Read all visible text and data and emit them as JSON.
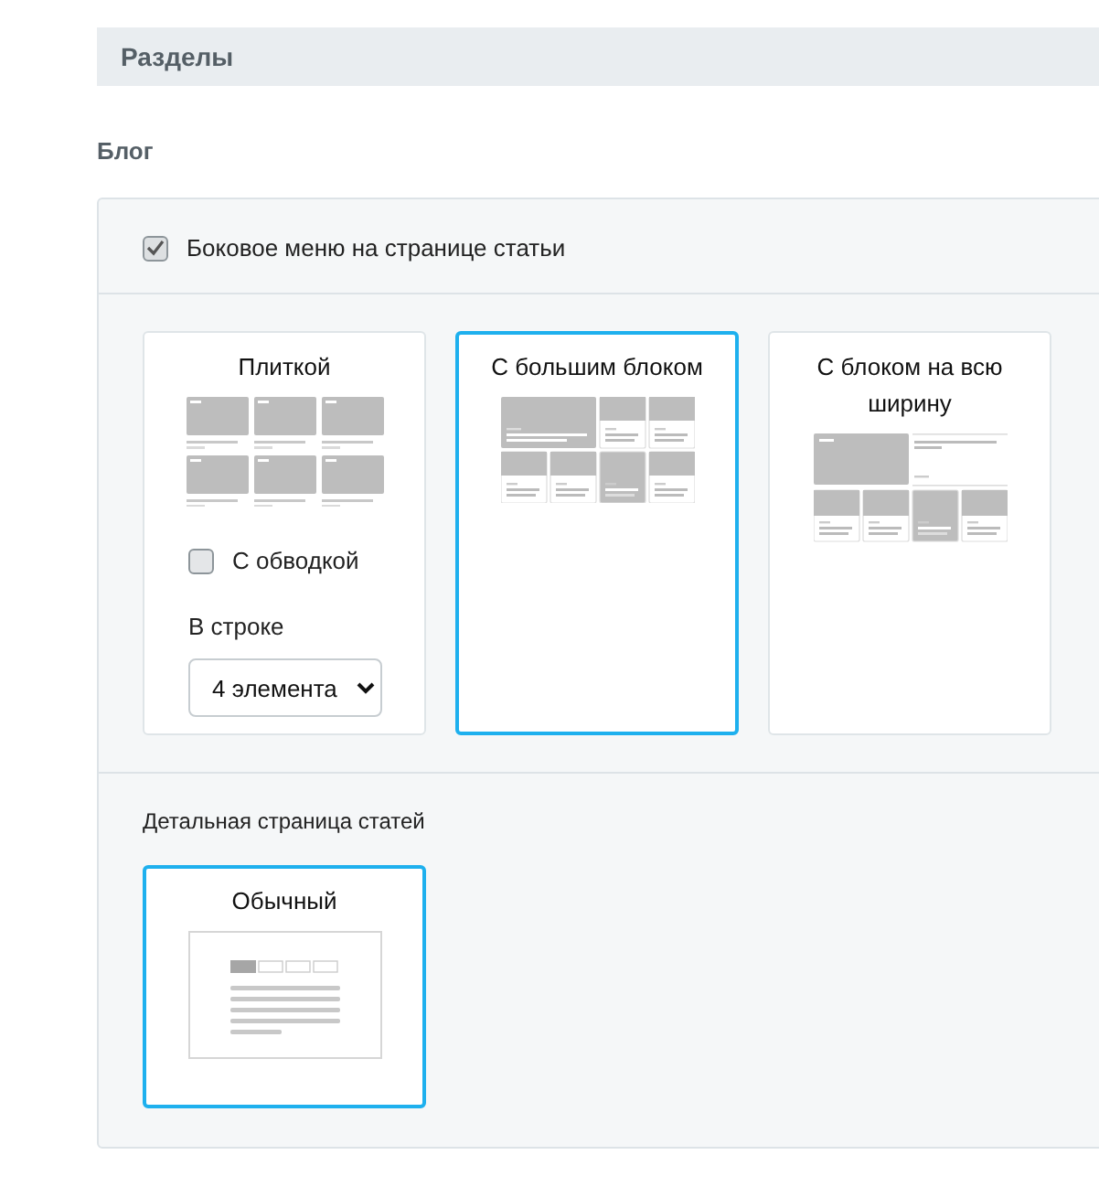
{
  "header": {
    "title": "Разделы"
  },
  "section": {
    "title": "Блог",
    "side_menu": {
      "label": "Боковое меню на странице статьи",
      "checked": true
    },
    "list_views": [
      {
        "kind": "tiles",
        "title": "Плиткой",
        "selected": false,
        "border_option": {
          "label": "С обводкой",
          "checked": false
        },
        "per_row": {
          "label": "В строке",
          "value": "4 элемента"
        }
      },
      {
        "kind": "big",
        "title": "С большим блоком",
        "selected": true
      },
      {
        "kind": "wide",
        "title": "С блоком на всю ширину",
        "selected": false
      }
    ],
    "detail": {
      "label": "Детальная страница статей",
      "views": [
        {
          "kind": "plain",
          "title": "Обычный",
          "selected": true
        }
      ]
    }
  }
}
